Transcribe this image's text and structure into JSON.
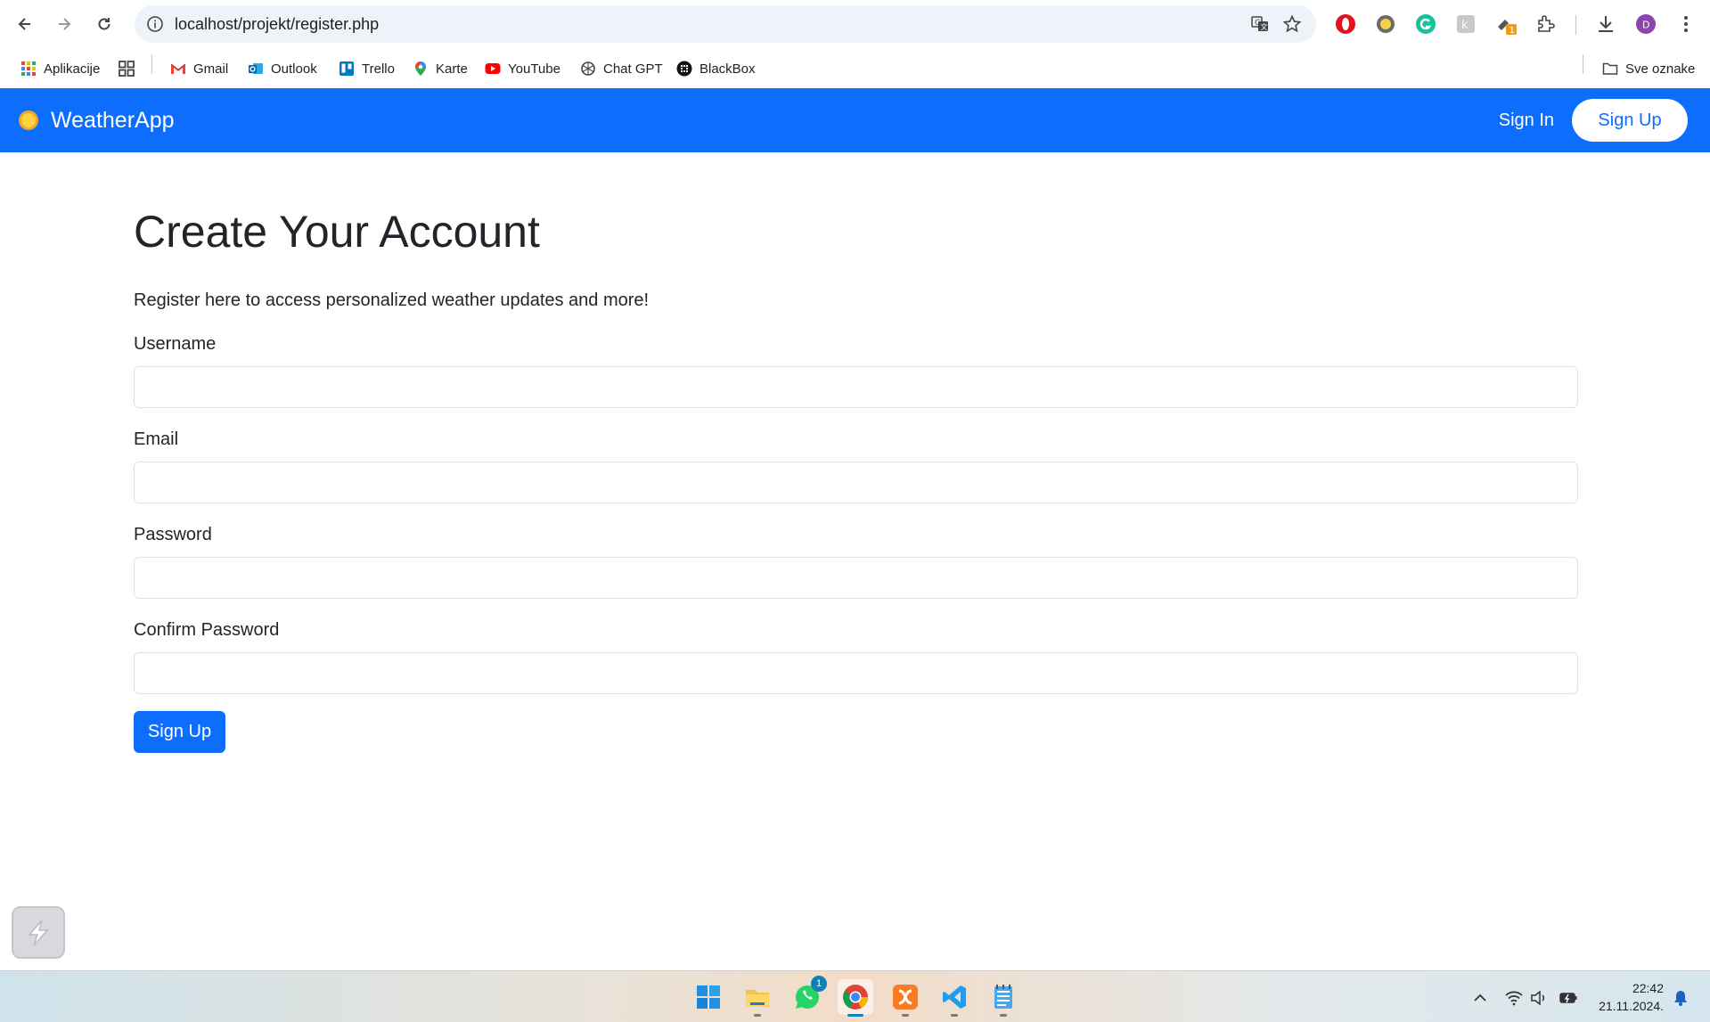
{
  "browser": {
    "url": "localhost/projekt/register.php",
    "bookmarks": [
      {
        "label": "Aplikacije",
        "icon": "apps-grid-icon"
      },
      {
        "label": "",
        "icon": "tab-groups-icon"
      },
      {
        "label": "Gmail",
        "icon": "gmail-icon"
      },
      {
        "label": "Outlook",
        "icon": "outlook-icon"
      },
      {
        "label": "Trello",
        "icon": "trello-icon"
      },
      {
        "label": "Karte",
        "icon": "maps-pin-icon"
      },
      {
        "label": "YouTube",
        "icon": "youtube-icon"
      },
      {
        "label": "Chat GPT",
        "icon": "chatgpt-icon"
      },
      {
        "label": "BlackBox",
        "icon": "blackbox-icon"
      }
    ],
    "all_bookmarks_label": "Sve oznake",
    "profile_initial": "D",
    "extension_badge": "1"
  },
  "navbar": {
    "brand": "WeatherApp",
    "sign_in": "Sign In",
    "sign_up": "Sign Up",
    "color": "#0d6efd"
  },
  "page": {
    "title": "Create Your Account",
    "lead": "Register here to access personalized weather updates and more!",
    "fields": {
      "username_label": "Username",
      "username_value": "",
      "email_label": "Email",
      "email_value": "",
      "password_label": "Password",
      "password_value": "",
      "confirm_label": "Confirm Password",
      "confirm_value": ""
    },
    "submit_label": "Sign Up"
  },
  "taskbar": {
    "apps": [
      "windows-start-icon",
      "file-explorer-icon",
      "whatsapp-icon",
      "chrome-icon",
      "xampp-icon",
      "vscode-icon",
      "notepad-icon"
    ],
    "whatsapp_badge": "1",
    "time": "22:42",
    "date": "21.11.2024."
  }
}
